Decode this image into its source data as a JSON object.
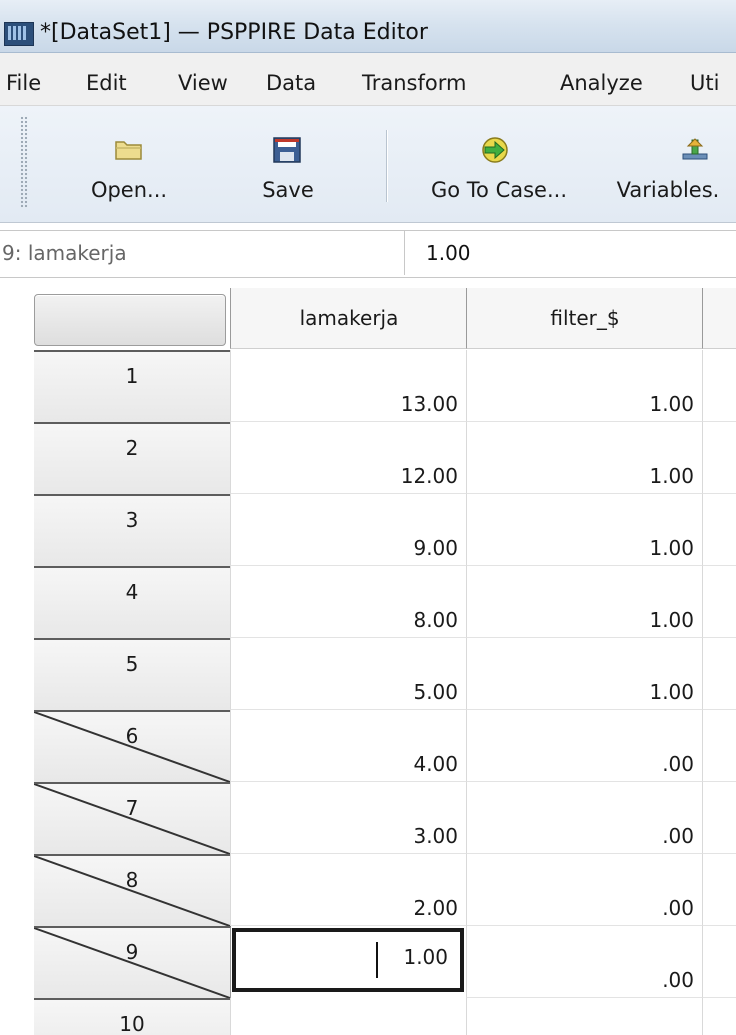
{
  "window": {
    "title": "*[DataSet1] — PSPPIRE Data Editor"
  },
  "menu": [
    "File",
    "Edit",
    "View",
    "Data",
    "Transform",
    "Analyze",
    "Uti"
  ],
  "toolbar": {
    "buttons": [
      {
        "label": "Open...",
        "icon": "folder-icon"
      },
      {
        "label": "Save",
        "icon": "floppy-disk-icon"
      },
      {
        "label": "Go To Case...",
        "icon": "arrow-right-icon"
      },
      {
        "label": "Variables.",
        "icon": "variables-icon"
      }
    ]
  },
  "reference": {
    "cell": "9: lamakerja",
    "value": "1.00"
  },
  "grid": {
    "columns": [
      "lamakerja",
      "filter_$"
    ],
    "rows": [
      {
        "case": "1",
        "lamakerja": "13.00",
        "filter": "1.00",
        "filtered_out": false
      },
      {
        "case": "2",
        "lamakerja": "12.00",
        "filter": "1.00",
        "filtered_out": false
      },
      {
        "case": "3",
        "lamakerja": "9.00",
        "filter": "1.00",
        "filtered_out": false
      },
      {
        "case": "4",
        "lamakerja": "8.00",
        "filter": "1.00",
        "filtered_out": false
      },
      {
        "case": "5",
        "lamakerja": "5.00",
        "filter": "1.00",
        "filtered_out": false
      },
      {
        "case": "6",
        "lamakerja": "4.00",
        "filter": ".00",
        "filtered_out": true
      },
      {
        "case": "7",
        "lamakerja": "3.00",
        "filter": ".00",
        "filtered_out": true
      },
      {
        "case": "8",
        "lamakerja": "2.00",
        "filter": ".00",
        "filtered_out": true
      },
      {
        "case": "9",
        "lamakerja": "1.00",
        "filter": ".00",
        "filtered_out": true,
        "active": true
      },
      {
        "case": "10",
        "lamakerja": "",
        "filter": "",
        "filtered_out": false
      }
    ]
  },
  "colors": {
    "accent": "#2c4f7a",
    "grid_border": "#9a9a9a"
  }
}
